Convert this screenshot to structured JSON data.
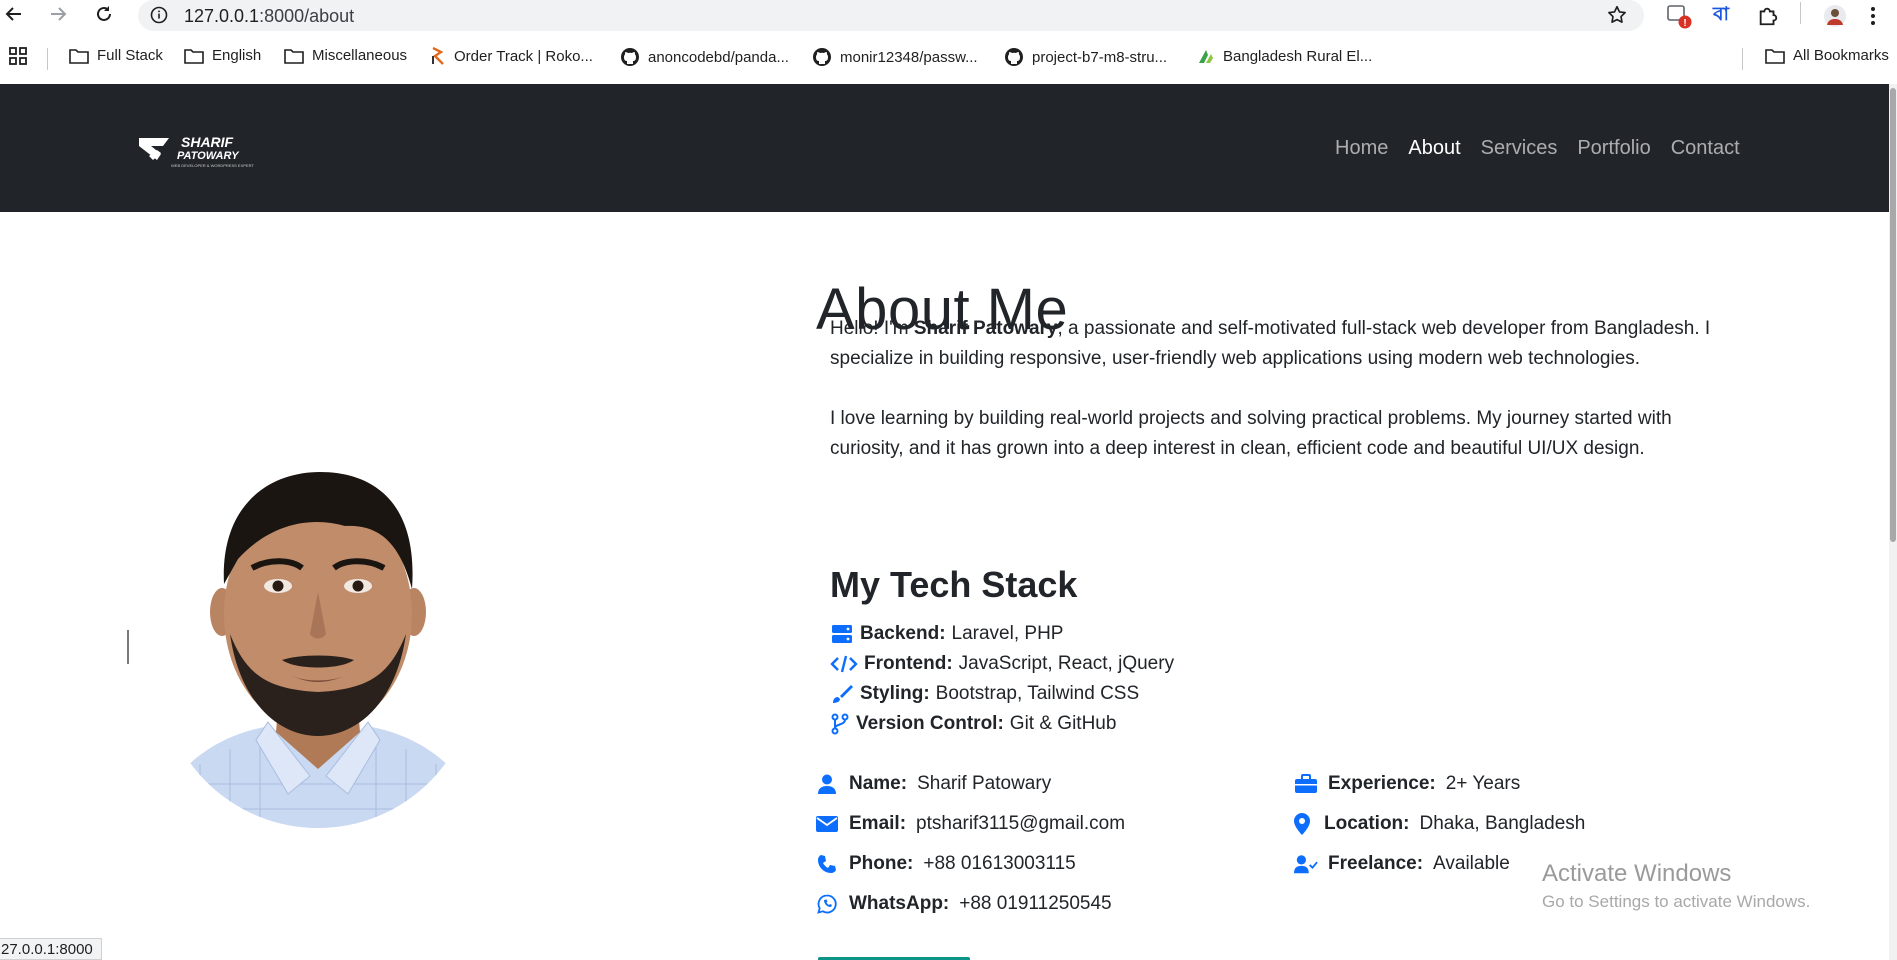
{
  "browser": {
    "url_host": "127.0.0.1",
    "url_rest": ":8000/about",
    "extension_badge": "!",
    "translate_label": "বা"
  },
  "bookmarks": {
    "items": [
      {
        "label": "Full Stack",
        "icon": "folder-icon"
      },
      {
        "label": "English",
        "icon": "folder-icon"
      },
      {
        "label": "Miscellaneous",
        "icon": "folder-icon"
      },
      {
        "label": "Order Track | Roko...",
        "icon": "rokomari-icon"
      },
      {
        "label": "anoncodebd/panda...",
        "icon": "github-icon"
      },
      {
        "label": "monir12348/passw...",
        "icon": "github-icon"
      },
      {
        "label": "project-b7-m8-stru...",
        "icon": "github-icon"
      },
      {
        "label": "Bangladesh Rural El...",
        "icon": "breb-icon"
      }
    ],
    "all_label": "All Bookmarks"
  },
  "site": {
    "logo_line1": "SHARIF",
    "logo_line2": "PATOWARY",
    "logo_tagline": "WEB DEVELOPER & WORDPRESS EXPERT",
    "nav": [
      {
        "label": "Home",
        "active": false
      },
      {
        "label": "About",
        "active": true
      },
      {
        "label": "Services",
        "active": false
      },
      {
        "label": "Portfolio",
        "active": false
      },
      {
        "label": "Contact",
        "active": false
      }
    ]
  },
  "about": {
    "title": "About Me",
    "p1_pre": "Hello! I'm ",
    "p1_name": "Sharif Patowary",
    "p1_post": ", a passionate and self-motivated full-stack web developer from Bangladesh. I specialize in building responsive, user-friendly web applications using modern web technologies.",
    "p2": "I love learning by building real-world projects and solving practical problems. My journey started with curiosity, and it has grown into a deep interest in clean, efficient code and beautiful UI/UX design."
  },
  "tech_stack": {
    "title": "My Tech Stack",
    "items": [
      {
        "label": "Backend:",
        "value": "Laravel, PHP",
        "icon": "server-icon"
      },
      {
        "label": "Frontend:",
        "value": "JavaScript, React, jQuery",
        "icon": "code-icon"
      },
      {
        "label": "Styling:",
        "value": "Bootstrap, Tailwind CSS",
        "icon": "brush-icon"
      },
      {
        "label": "Version Control:",
        "value": "Git & GitHub",
        "icon": "git-branch-icon"
      }
    ]
  },
  "info": {
    "left": [
      {
        "label": "Name:",
        "value": "Sharif Patowary",
        "icon": "user-icon"
      },
      {
        "label": "Email:",
        "value": "ptsharif3115@gmail.com",
        "icon": "envelope-icon"
      },
      {
        "label": "Phone:",
        "value": "+88 01613003115",
        "icon": "phone-icon"
      },
      {
        "label": "WhatsApp:",
        "value": "+88 01911250545",
        "icon": "whatsapp-icon"
      }
    ],
    "right": [
      {
        "label": "Experience:",
        "value": "2+ Years",
        "icon": "briefcase-icon"
      },
      {
        "label": "Location:",
        "value": "Dhaka, Bangladesh",
        "icon": "map-pin-icon"
      },
      {
        "label": "Freelance:",
        "value": "Available",
        "icon": "user-check-icon"
      }
    ]
  },
  "windows_watermark": {
    "line1": "Activate Windows",
    "line2": "Go to Settings to activate Windows."
  },
  "status_bar": "27.0.0.1:8000",
  "colors": {
    "accent": "#0d6efd",
    "navbar": "#212529"
  }
}
